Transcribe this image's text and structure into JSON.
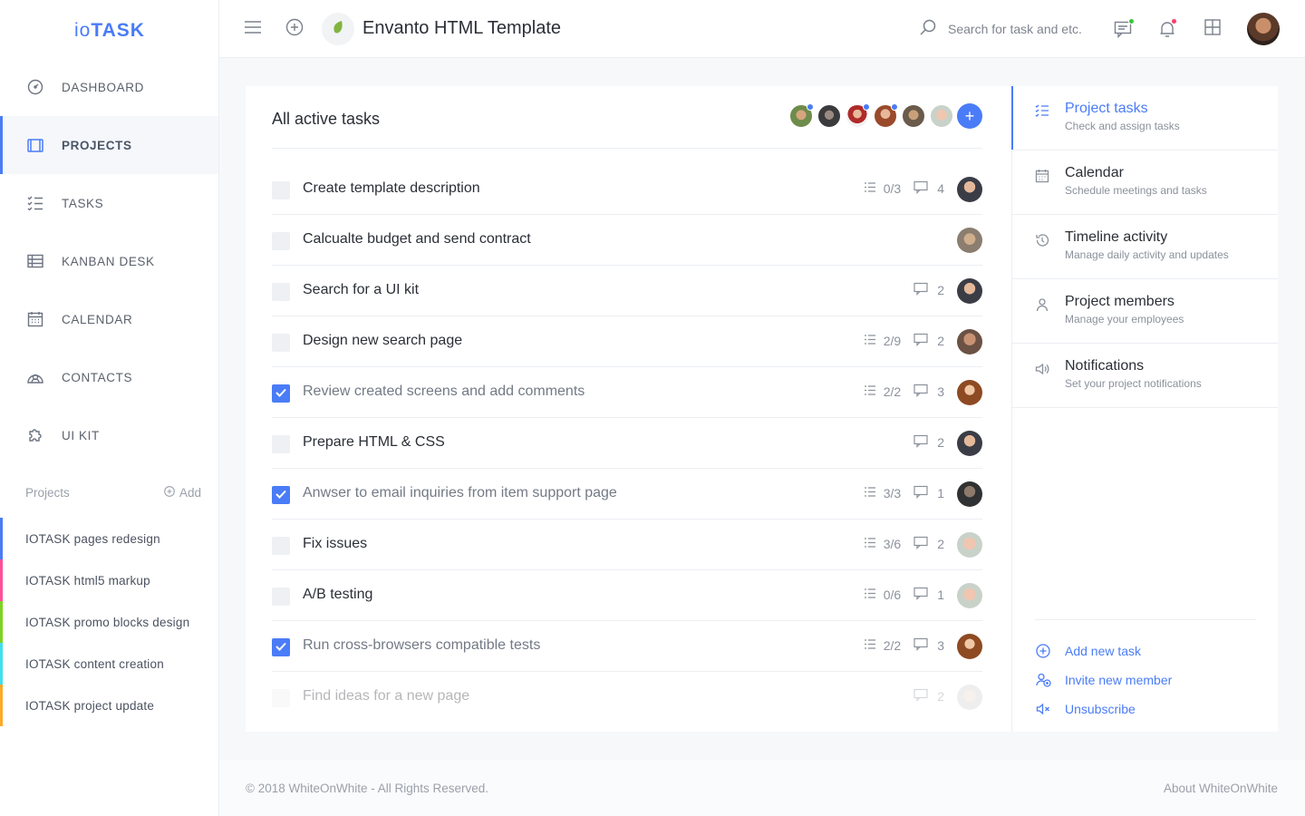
{
  "app": {
    "logo_light": "io",
    "logo_bold": "TASK"
  },
  "sidebar": {
    "items": [
      {
        "label": "DASHBOARD",
        "icon": "gauge-icon"
      },
      {
        "label": "PROJECTS",
        "icon": "briefcase-icon",
        "active": true
      },
      {
        "label": "TASKS",
        "icon": "checklist-icon"
      },
      {
        "label": "KANBAN DESK",
        "icon": "table-icon"
      },
      {
        "label": "CALENDAR",
        "icon": "calendar-icon"
      },
      {
        "label": "CONTACTS",
        "icon": "contacts-icon"
      },
      {
        "label": "UI KIT",
        "icon": "puzzle-icon"
      }
    ],
    "projects_label": "Projects",
    "add_label": "Add",
    "projects": [
      {
        "name": "IOTASK pages redesign",
        "color": "#4a7cf7"
      },
      {
        "name": "IOTASK html5 markup",
        "color": "#ff4f9a"
      },
      {
        "name": "IOTASK promo blocks design",
        "color": "#7ed321"
      },
      {
        "name": "IOTASK content creation",
        "color": "#3fe0f0"
      },
      {
        "name": "IOTASK project update",
        "color": "#ffa927"
      }
    ]
  },
  "header": {
    "title": "Envanto HTML Template",
    "search_placeholder": "Search for task and etc.",
    "notif_dot_color": "#ff3b6b",
    "chat_dot_color": "#3ac43a"
  },
  "tasks": {
    "title": "All active tasks",
    "items": [
      {
        "name": "Create template description",
        "checklist": "0/3",
        "comments": "4",
        "done": false
      },
      {
        "name": "Calcualte budget and send contract",
        "checklist": "",
        "comments": "",
        "done": false
      },
      {
        "name": "Search for a UI kit",
        "checklist": "",
        "comments": "2",
        "done": false
      },
      {
        "name": "Design new search page",
        "checklist": "2/9",
        "comments": "2",
        "done": false
      },
      {
        "name": "Review created screens and add comments",
        "checklist": "2/2",
        "comments": "3",
        "done": true
      },
      {
        "name": "Prepare HTML & CSS",
        "checklist": "",
        "comments": "2",
        "done": false
      },
      {
        "name": "Anwser to email inquiries from item support page",
        "checklist": "3/3",
        "comments": "1",
        "done": true
      },
      {
        "name": "Fix issues",
        "checklist": "3/6",
        "comments": "2",
        "done": false
      },
      {
        "name": "A/B testing",
        "checklist": "0/6",
        "comments": "1",
        "done": false
      },
      {
        "name": "Run cross-browsers compatible tests",
        "checklist": "2/2",
        "comments": "3",
        "done": true
      },
      {
        "name": "Find ideas for a new page",
        "checklist": "",
        "comments": "2",
        "done": false
      }
    ]
  },
  "panel": {
    "items": [
      {
        "title": "Project tasks",
        "sub": "Check and assign tasks",
        "icon": "checklist-icon"
      },
      {
        "title": "Calendar",
        "sub": "Schedule meetings and tasks",
        "icon": "calendar-icon"
      },
      {
        "title": "Timeline activity",
        "sub": "Manage daily activity and updates",
        "icon": "history-icon"
      },
      {
        "title": "Project members",
        "sub": "Manage your employees",
        "icon": "user-icon"
      },
      {
        "title": "Notifications",
        "sub": "Set your project notifications",
        "icon": "speaker-icon"
      }
    ],
    "actions": [
      {
        "label": "Add new task",
        "icon": "plus-circle-icon"
      },
      {
        "label": "Invite new member",
        "icon": "user-plus-icon"
      },
      {
        "label": "Unsubscribe",
        "icon": "mute-icon"
      }
    ]
  },
  "footer": {
    "copyright": "© 2018 WhiteOnWhite - All Rights Reserved.",
    "about": "About WhiteOnWhite"
  }
}
